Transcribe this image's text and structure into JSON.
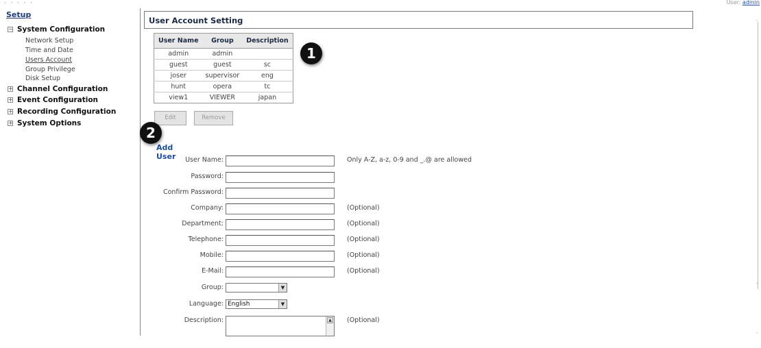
{
  "header": {
    "dots": "• • • • •",
    "user_label": "User: ",
    "user_link": "admin"
  },
  "sidebar": {
    "title": "Setup",
    "groups": [
      {
        "label": "System Configuration",
        "toggle": "⊟",
        "items": [
          "Network Setup",
          "Time and Date",
          "Users Account",
          "Group Privilege",
          "Disk Setup"
        ]
      },
      {
        "label": "Channel Configuration",
        "toggle": "⊞"
      },
      {
        "label": "Event Configuration",
        "toggle": "⊞"
      },
      {
        "label": "Recording Configuration",
        "toggle": "⊞"
      },
      {
        "label": "System Options",
        "toggle": "⊞"
      }
    ],
    "active_item": "Users Account"
  },
  "main": {
    "title": "User Account Setting",
    "table": {
      "headers": [
        "User Name",
        "Group",
        "Description"
      ],
      "rows": [
        [
          "admin",
          "admin",
          ""
        ],
        [
          "guest",
          "guest",
          "sc"
        ],
        [
          "joser",
          "supervisor",
          "eng"
        ],
        [
          "hunt",
          "opera",
          "tc"
        ],
        [
          "view1",
          "VIEWER",
          "japan"
        ]
      ]
    },
    "buttons": {
      "edit": "Edit",
      "remove": "Remove"
    },
    "markers": [
      "1",
      "2"
    ],
    "add_user": {
      "title": "Add User",
      "fields": {
        "username": {
          "label": "User Name:",
          "value": "",
          "note": "Only A-Z, a-z, 0-9 and _.@ are allowed"
        },
        "password": {
          "label": "Password:",
          "value": ""
        },
        "confirm": {
          "label": "Confirm Password:",
          "value": ""
        },
        "company": {
          "label": "Company:",
          "value": "",
          "note": "(Optional)"
        },
        "department": {
          "label": "Department:",
          "value": "",
          "note": "(Optional)"
        },
        "telephone": {
          "label": "Telephone:",
          "value": "",
          "note": "(Optional)"
        },
        "mobile": {
          "label": "Mobile:",
          "value": "",
          "note": "(Optional)"
        },
        "email": {
          "label": "E-Mail:",
          "value": "",
          "note": "(Optional)"
        },
        "group": {
          "label": "Group:",
          "value": ""
        },
        "language": {
          "label": "Language:",
          "value": "English"
        },
        "description": {
          "label": "Description:",
          "value": "",
          "note": "(Optional)"
        }
      },
      "arrow_glyph": "▼",
      "scroll_up_glyph": "▲"
    }
  }
}
